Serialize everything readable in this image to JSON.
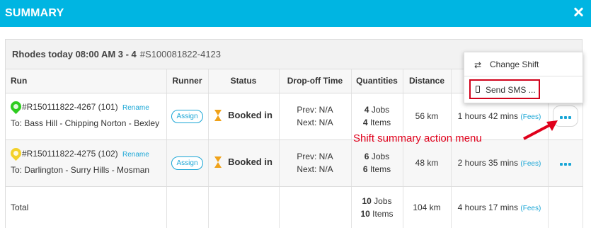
{
  "header": {
    "title": "SUMMARY"
  },
  "shift": {
    "title": "Rhodes today 08:00 AM 3 - 4",
    "id": "#S100081822-4123"
  },
  "columns": [
    "Run",
    "Runner",
    "Status",
    "Drop-off Time",
    "Quantities",
    "Distance",
    "",
    ""
  ],
  "rows": [
    {
      "pin_color": "#2ecc1f",
      "run_id": "#R150111822-4267 (101)",
      "rename": "Rename",
      "to": "To: Bass Hill - Chipping Norton - Bexley",
      "runner": "Assign",
      "status": "Booked in",
      "prev": "Prev: N/A",
      "next": "Next: N/A",
      "jobs_count": "4",
      "jobs_label": "Jobs",
      "items_count": "4",
      "items_label": "Items",
      "distance": "56 km",
      "duration": "1 hours 42 mins",
      "fees": "(Fees)"
    },
    {
      "pin_color": "#f3d12a",
      "run_id": "#R150111822-4275 (102)",
      "rename": "Rename",
      "to": "To: Darlington - Surry Hills - Mosman",
      "runner": "Assign",
      "status": "Booked in",
      "prev": "Prev: N/A",
      "next": "Next: N/A",
      "jobs_count": "6",
      "jobs_label": "Jobs",
      "items_count": "6",
      "items_label": "Items",
      "distance": "48 km",
      "duration": "2 hours 35 mins",
      "fees": "(Fees)"
    }
  ],
  "total": {
    "label": "Total",
    "jobs_count": "10",
    "jobs_label": "Jobs",
    "items_count": "10",
    "items_label": "Items",
    "distance": "104 km",
    "duration": "4 hours 17 mins",
    "fees": "(Fees)"
  },
  "menu": {
    "change_shift": "Change Shift",
    "change_shift_icon": "shuffle-icon",
    "send_sms": "Send SMS ...",
    "send_sms_icon": "mobile-phone-icon"
  },
  "annotation": {
    "text": "Shift summary action menu",
    "color": "#e0001b"
  },
  "colors": {
    "header": "#00b5e2",
    "accent": "#1aa6d6",
    "status": "#f0a21a"
  }
}
